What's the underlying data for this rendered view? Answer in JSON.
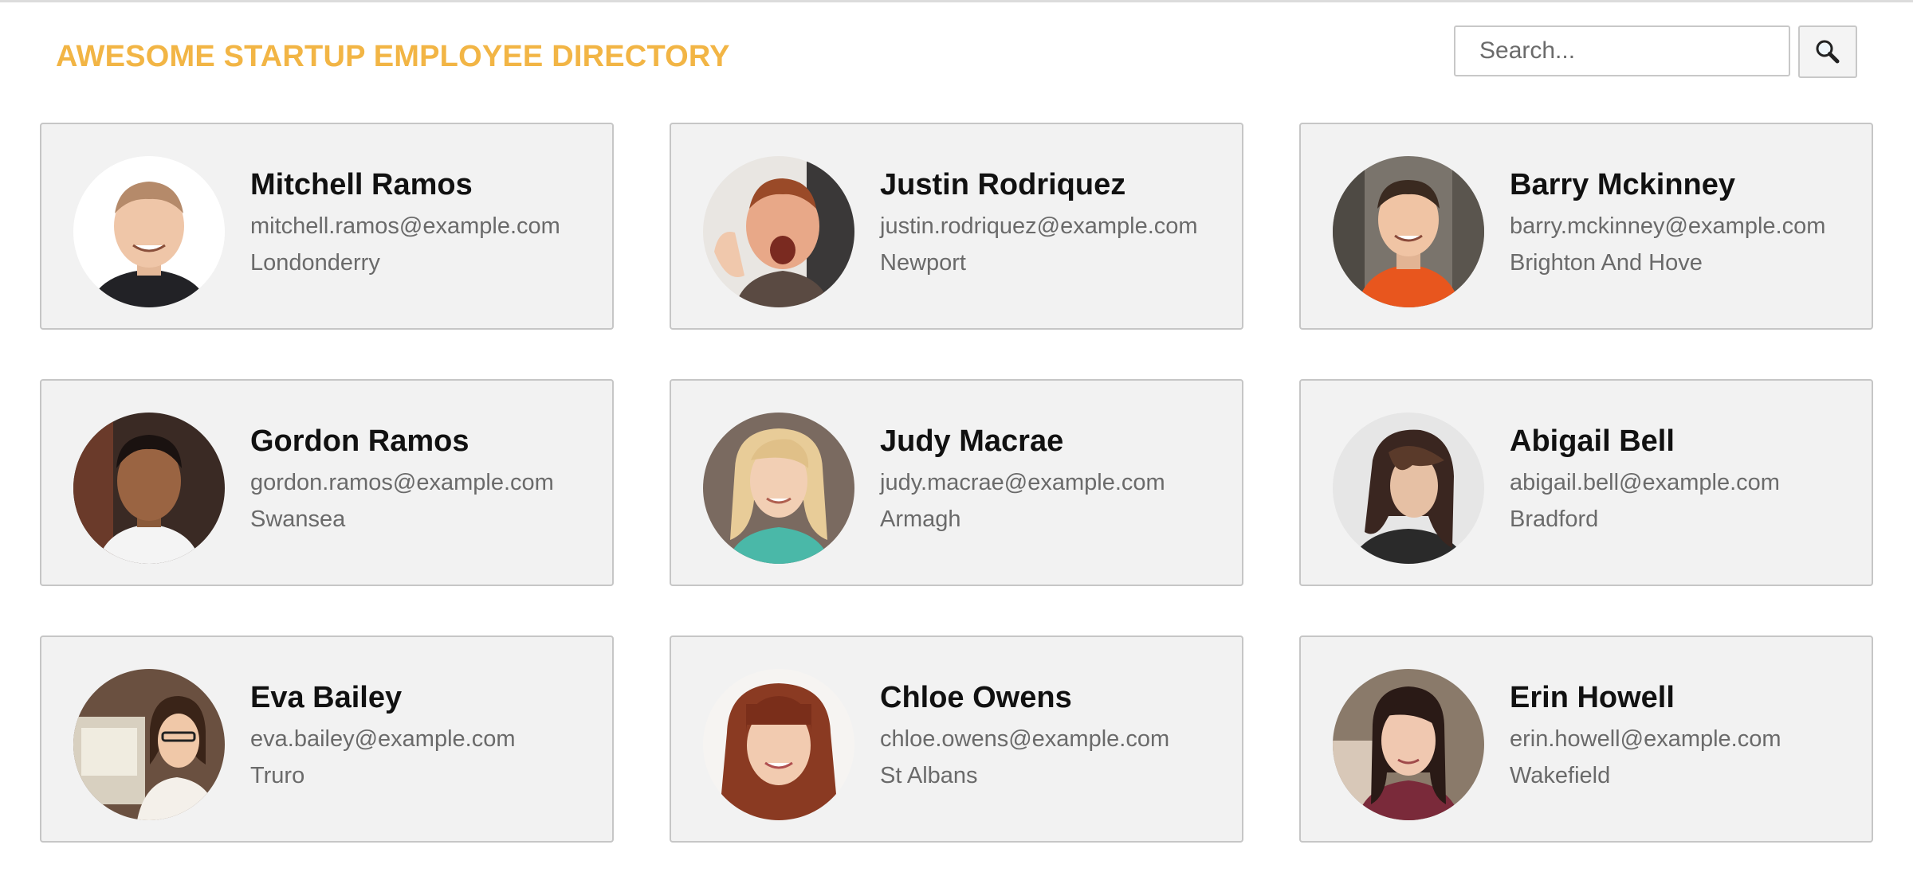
{
  "header": {
    "title": "AWESOME STARTUP EMPLOYEE DIRECTORY",
    "accent_color": "#f2b545"
  },
  "search": {
    "placeholder": "Search...",
    "value": "",
    "button_icon": "magnifier-icon"
  },
  "employees": [
    {
      "name": "Mitchell Ramos",
      "email": "mitchell.ramos@example.com",
      "city": "Londonderry"
    },
    {
      "name": "Justin Rodriquez",
      "email": "justin.rodriquez@example.com",
      "city": "Newport"
    },
    {
      "name": "Barry Mckinney",
      "email": "barry.mckinney@example.com",
      "city": "Brighton And Hove"
    },
    {
      "name": "Gordon Ramos",
      "email": "gordon.ramos@example.com",
      "city": "Swansea"
    },
    {
      "name": "Judy Macrae",
      "email": "judy.macrae@example.com",
      "city": "Armagh"
    },
    {
      "name": "Abigail Bell",
      "email": "abigail.bell@example.com",
      "city": "Bradford"
    },
    {
      "name": "Eva Bailey",
      "email": "eva.bailey@example.com",
      "city": "Truro"
    },
    {
      "name": "Chloe Owens",
      "email": "chloe.owens@example.com",
      "city": "St Albans"
    },
    {
      "name": "Erin Howell",
      "email": "erin.howell@example.com",
      "city": "Wakefield"
    }
  ]
}
